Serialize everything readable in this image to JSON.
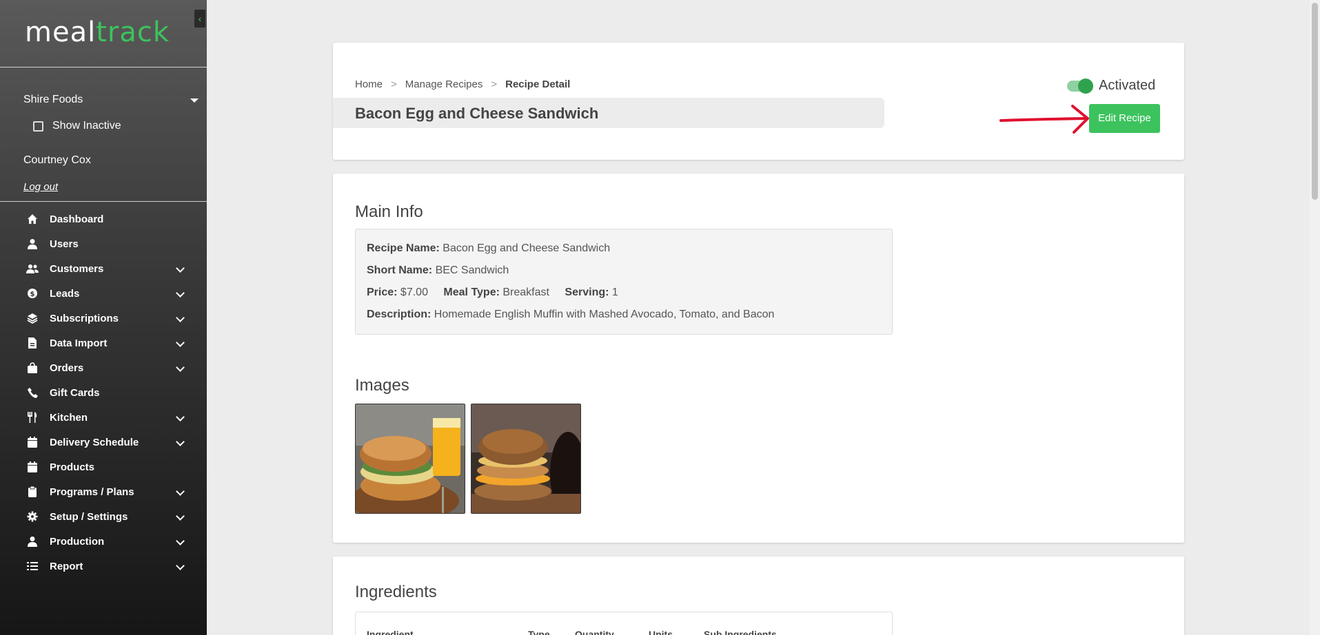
{
  "sidebar": {
    "logo_left": "meal",
    "logo_right": "track",
    "company": "Shire Foods",
    "show_inactive": "Show Inactive",
    "user_name": "Courtney Cox",
    "logout": "Log out",
    "nav": [
      {
        "label": "Dashboard",
        "icon": "home-icon",
        "expandable": false
      },
      {
        "label": "Users",
        "icon": "user-icon",
        "expandable": false
      },
      {
        "label": "Customers",
        "icon": "users-icon",
        "expandable": true
      },
      {
        "label": "Leads",
        "icon": "dollar-icon",
        "expandable": true
      },
      {
        "label": "Subscriptions",
        "icon": "layers-icon",
        "expandable": true
      },
      {
        "label": "Data Import",
        "icon": "file-icon",
        "expandable": true
      },
      {
        "label": "Orders",
        "icon": "bag-icon",
        "expandable": true
      },
      {
        "label": "Gift Cards",
        "icon": "phone-icon",
        "expandable": false
      },
      {
        "label": "Kitchen",
        "icon": "utensils-icon",
        "expandable": true
      },
      {
        "label": "Delivery Schedule",
        "icon": "calendar-icon",
        "expandable": true
      },
      {
        "label": "Products",
        "icon": "calendar-icon",
        "expandable": false
      },
      {
        "label": "Programs / Plans",
        "icon": "clipboard-icon",
        "expandable": true
      },
      {
        "label": "Setup / Settings",
        "icon": "gear-icon",
        "expandable": true
      },
      {
        "label": "Production",
        "icon": "user-icon",
        "expandable": true
      },
      {
        "label": "Report",
        "icon": "list-icon",
        "expandable": true
      }
    ]
  },
  "header": {
    "breadcrumb": [
      "Home",
      "Manage Recipes",
      "Recipe Detail"
    ],
    "breadcrumb_sep": ">",
    "title": "Bacon Egg and Cheese Sandwich",
    "toggle_label": "Activated",
    "edit_button": "Edit Recipe"
  },
  "main_info": {
    "heading": "Main Info",
    "recipe_name_label": "Recipe Name:",
    "recipe_name": "Bacon Egg and Cheese Sandwich",
    "short_name_label": "Short Name:",
    "short_name": "BEC Sandwich",
    "price_label": "Price:",
    "price": "$7.00",
    "meal_type_label": "Meal Type:",
    "meal_type": "Breakfast",
    "serving_label": "Serving:",
    "serving": "1",
    "description_label": "Description:",
    "description": "Homemade English Muffin with Mashed Avocado, Tomato, and Bacon"
  },
  "images": {
    "heading": "Images"
  },
  "ingredients": {
    "heading": "Ingredients",
    "columns": [
      "Ingredient",
      "Type",
      "Quantity",
      "Units",
      "Sub Ingredients"
    ]
  },
  "colors": {
    "accent": "#3cc35d",
    "annotation_arrow": "#e0102f"
  }
}
